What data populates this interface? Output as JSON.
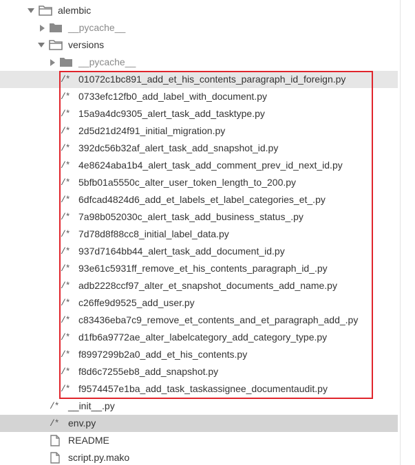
{
  "tree": {
    "folders": {
      "alembic": "alembic",
      "pycache_1": "__pycache__",
      "versions": "versions",
      "pycache_2": "__pycache__"
    },
    "file_icon_glyph": "/*",
    "migration_files": [
      "01072c1bc891_add_et_his_contents_paragraph_id_foreign.py",
      "0733efc12fb0_add_label_with_document.py",
      "15a9a4dc9305_alert_task_add_tasktype.py",
      "2d5d21d24f91_initial_migration.py",
      "392dc56b32af_alert_task_add_snapshot_id.py",
      "4e8624aba1b4_alert_task_add_comment_prev_id_next_id.py",
      "5bfb01a5550c_alter_user_token_length_to_200.py",
      "6dfcad4824d6_add_et_labels_et_label_categories_et_.py",
      "7a98b052030c_alert_task_add_business_status_.py",
      "7d78d8f88cc8_initial_label_data.py",
      "937d7164bb44_alert_task_add_document_id.py",
      "93e61c5931ff_remove_et_his_contents_paragraph_id_.py",
      "adb2228ccf97_alter_et_snapshot_documents_add_name.py",
      "c26ffe9d9525_add_user.py",
      "c83436eba7c9_remove_et_contents_and_et_paragraph_add_.py",
      "d1fb6a9772ae_alter_labelcategory_add_category_type.py",
      "f8997299b2a0_add_et_his_contents.py",
      "f8d6c7255eb8_add_snapshot.py",
      "f9574457e1ba_add_task_taskassignee_documentaudit.py"
    ],
    "alembic_files": {
      "init": "__init__.py",
      "env": "env.py",
      "readme": "README",
      "script_mako": "script.py.mako"
    }
  },
  "colors": {
    "highlight": "#e6e6e6",
    "selected": "#d4d4d4",
    "selection_box": "#e0242b",
    "folder_icon": "#7f7f7f",
    "muted_text": "#8a8a8a"
  }
}
